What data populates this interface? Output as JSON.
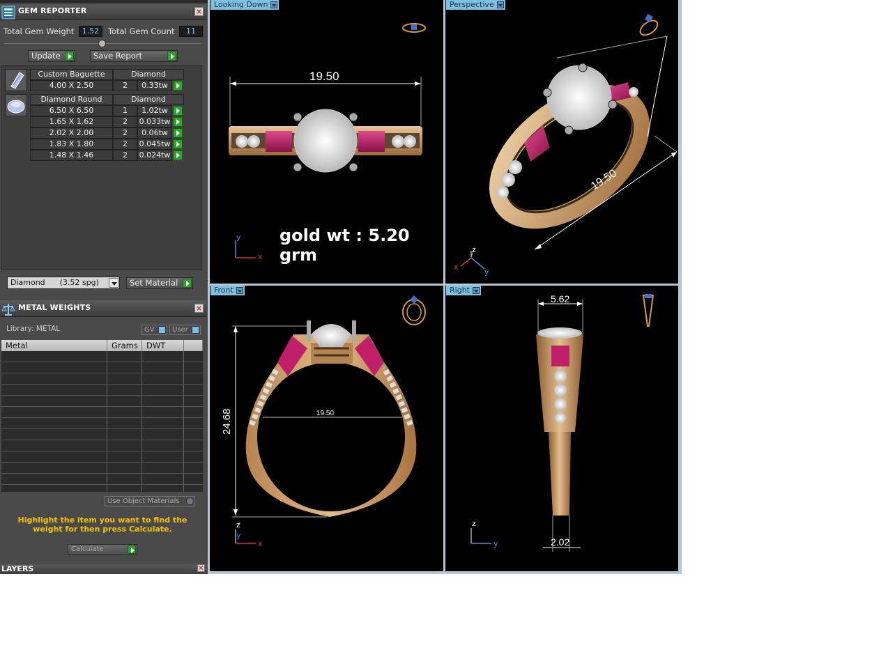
{
  "gem_reporter": {
    "title": "GEM REPORTER",
    "total_weight_label": "Total Gem Weight",
    "total_weight_value": "1.52",
    "total_count_label": "Total Gem Count",
    "total_count_value": "11",
    "update_label": "Update",
    "save_report_label": "Save Report",
    "groups": [
      {
        "cut": "Custom Baguette",
        "material": "Diamond",
        "rows": [
          {
            "size": "4.00 X 2.50",
            "qty": "2",
            "weight": "0.33tw"
          }
        ]
      },
      {
        "cut": "Diamond Round",
        "material": "Diamond",
        "rows": [
          {
            "size": "6.50 X 6.50",
            "qty": "1",
            "weight": "1.02tw"
          },
          {
            "size": "1.65 X 1.62",
            "qty": "2",
            "weight": "0.033tw"
          },
          {
            "size": "2.02 X 2.00",
            "qty": "2",
            "weight": "0.06tw"
          },
          {
            "size": "1.83 X 1.80",
            "qty": "2",
            "weight": "0.045tw"
          },
          {
            "size": "1.48 X 1.46",
            "qty": "2",
            "weight": "0.024tw"
          }
        ]
      }
    ],
    "material_select": "Diamond      (3.52 spg)",
    "set_material_label": "Set Material"
  },
  "metal_weights": {
    "title": "METAL WEIGHTS",
    "library_label": "Library: METAL",
    "gv_label": "GV",
    "user_label": "User",
    "columns": [
      "Metal",
      "Grams",
      "DWT"
    ],
    "use_object_materials_label": "Use Object Materials",
    "hint": "Highlight the item you want to find the weight for then press Calculate.",
    "calculate_label": "Calculate"
  },
  "layers": {
    "title": "LAYERS"
  },
  "viewports": {
    "top": {
      "tab": "Looking Down",
      "dimension": "19.50",
      "annotation": "gold wt : 5.20 grm",
      "axis1": "y",
      "axis2": "x"
    },
    "perspective": {
      "tab": "Perspective",
      "dimension": "19.50",
      "axis1": "z",
      "axis2": "x",
      "axis3": "y"
    },
    "front": {
      "tab": "Front",
      "dimension_height": "24.68",
      "dimension_inner": "19.50",
      "axis1": "z",
      "axis2": "y",
      "axis3": "x"
    },
    "right": {
      "tab": "Right",
      "dimension_top": "5.62",
      "dimension_bottom": "2.02",
      "axis1": "z",
      "axis2": "y"
    }
  },
  "colors": {
    "gold": "#c8955e",
    "ruby": "#c0206a",
    "accent_blue": "#7fbfe0",
    "hint_yellow": "#f5c400",
    "go_green": "#2fa32f"
  }
}
